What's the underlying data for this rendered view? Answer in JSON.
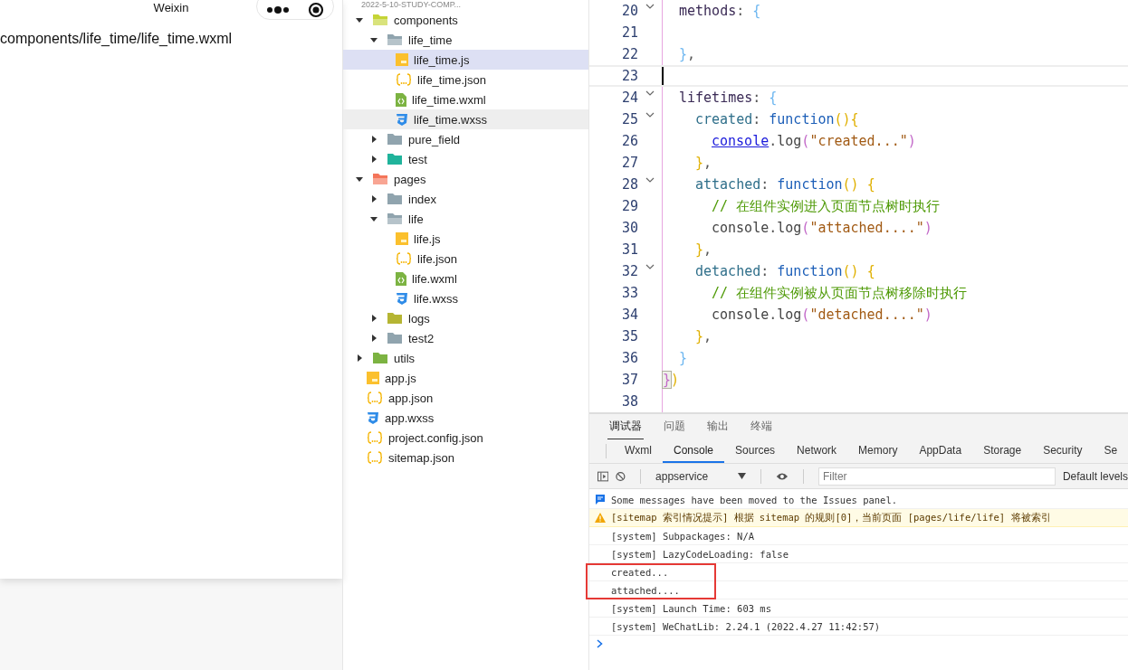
{
  "simulator": {
    "title": "Weixin",
    "page_text": "components/life_time/life_time.wxml"
  },
  "explorer": {
    "project": "2022-5-10-STUDY-COMP...",
    "tree": [
      {
        "name": "components",
        "kind": "folder",
        "color": "#c5d436",
        "expanded": true,
        "selected": false,
        "hovered": false,
        "children": [
          {
            "name": "life_time",
            "kind": "folder",
            "color": "#90a4ae",
            "expanded": true,
            "selected": false,
            "hovered": false,
            "children": [
              {
                "name": "life_time.js",
                "kind": "js",
                "selected": true,
                "hovered": false
              },
              {
                "name": "life_time.json",
                "kind": "json",
                "selected": false,
                "hovered": false
              },
              {
                "name": "life_time.wxml",
                "kind": "wxml",
                "selected": false,
                "hovered": false
              },
              {
                "name": "life_time.wxss",
                "kind": "wxss",
                "selected": false,
                "hovered": true
              }
            ]
          },
          {
            "name": "pure_field",
            "kind": "folder",
            "color": "#90a4ae",
            "expanded": false,
            "selected": false,
            "hovered": false
          },
          {
            "name": "test",
            "kind": "folder",
            "color": "#20b39b",
            "expanded": false,
            "selected": false,
            "hovered": false
          }
        ]
      },
      {
        "name": "pages",
        "kind": "folder",
        "color": "#f4755a",
        "expanded": true,
        "selected": false,
        "hovered": false,
        "children": [
          {
            "name": "index",
            "kind": "folder",
            "color": "#90a4ae",
            "expanded": false,
            "selected": false,
            "hovered": false
          },
          {
            "name": "life",
            "kind": "folder",
            "color": "#90a4ae",
            "expanded": true,
            "selected": false,
            "hovered": false,
            "children": [
              {
                "name": "life.js",
                "kind": "js",
                "selected": false,
                "hovered": false
              },
              {
                "name": "life.json",
                "kind": "json",
                "selected": false,
                "hovered": false
              },
              {
                "name": "life.wxml",
                "kind": "wxml",
                "selected": false,
                "hovered": false
              },
              {
                "name": "life.wxss",
                "kind": "wxss",
                "selected": false,
                "hovered": false
              }
            ]
          },
          {
            "name": "logs",
            "kind": "folder",
            "color": "#b5b533",
            "expanded": false,
            "selected": false,
            "hovered": false
          },
          {
            "name": "test2",
            "kind": "folder",
            "color": "#90a4ae",
            "expanded": false,
            "selected": false,
            "hovered": false
          }
        ]
      },
      {
        "name": "utils",
        "kind": "folder",
        "color": "#7cb342",
        "expanded": false,
        "selected": false,
        "hovered": false
      },
      {
        "name": "app.js",
        "kind": "js",
        "selected": false,
        "hovered": false
      },
      {
        "name": "app.json",
        "kind": "json",
        "selected": false,
        "hovered": false
      },
      {
        "name": "app.wxss",
        "kind": "wxss",
        "selected": false,
        "hovered": false
      },
      {
        "name": "project.config.json",
        "kind": "json",
        "selected": false,
        "hovered": false
      },
      {
        "name": "sitemap.json",
        "kind": "json",
        "selected": false,
        "hovered": false
      }
    ]
  },
  "editor": {
    "lines": [
      {
        "number": "20",
        "foldable": true,
        "current": false,
        "tokens": [
          {
            "text": "methods",
            "kind": "prop"
          },
          {
            "text": ": ",
            "kind": "punct"
          },
          {
            "text": "{",
            "kind": "brace"
          }
        ]
      },
      {
        "number": "21",
        "foldable": false,
        "current": false
      },
      {
        "number": "22",
        "foldable": false,
        "current": false,
        "tokens": [
          {
            "text": "}",
            "kind": "brace"
          },
          {
            "text": ",",
            "kind": "punct"
          }
        ]
      },
      {
        "number": "23",
        "foldable": false,
        "current": true
      },
      {
        "number": "24",
        "foldable": true,
        "current": false,
        "tokens": [
          {
            "text": "lifetimes",
            "kind": "prop"
          },
          {
            "text": ": ",
            "kind": "punct"
          },
          {
            "text": "{",
            "kind": "brace"
          }
        ]
      },
      {
        "number": "25",
        "foldable": true,
        "current": false,
        "tokens": [
          {
            "text": "created",
            "kind": "key"
          },
          {
            "text": ": ",
            "kind": "punct"
          },
          {
            "text": "function",
            "kind": "fn"
          },
          {
            "text": "(){",
            "kind": "brace2"
          }
        ]
      },
      {
        "number": "26",
        "foldable": false,
        "current": false,
        "tokens": [
          {
            "text": "console",
            "kind": "link"
          },
          {
            "text": ".",
            "kind": "punct"
          },
          {
            "text": "log",
            "kind": "ident"
          },
          {
            "text": "(",
            "kind": "paren"
          },
          {
            "text": "\"created...\"",
            "kind": "str"
          },
          {
            "text": ")",
            "kind": "paren"
          }
        ]
      },
      {
        "number": "27",
        "foldable": false,
        "current": false,
        "tokens": [
          {
            "text": "}",
            "kind": "brace2"
          },
          {
            "text": ",",
            "kind": "punct"
          }
        ]
      },
      {
        "number": "28",
        "foldable": true,
        "current": false,
        "tokens": [
          {
            "text": "attached",
            "kind": "key"
          },
          {
            "text": ": ",
            "kind": "punct"
          },
          {
            "text": "function",
            "kind": "fn"
          },
          {
            "text": "() {",
            "kind": "brace2"
          }
        ]
      },
      {
        "number": "29",
        "foldable": false,
        "current": false,
        "tokens": [
          {
            "text": "// 在组件实例进入页面节点树时执行",
            "kind": "comment"
          }
        ]
      },
      {
        "number": "30",
        "foldable": false,
        "current": false,
        "tokens": [
          {
            "text": "console",
            "kind": "ident"
          },
          {
            "text": ".",
            "kind": "punct"
          },
          {
            "text": "log",
            "kind": "ident"
          },
          {
            "text": "(",
            "kind": "paren"
          },
          {
            "text": "\"attached....\"",
            "kind": "str"
          },
          {
            "text": ")",
            "kind": "paren"
          }
        ]
      },
      {
        "number": "31",
        "foldable": false,
        "current": false,
        "tokens": [
          {
            "text": "}",
            "kind": "brace2"
          },
          {
            "text": ",",
            "kind": "punct"
          }
        ]
      },
      {
        "number": "32",
        "foldable": true,
        "current": false,
        "tokens": [
          {
            "text": "detached",
            "kind": "key"
          },
          {
            "text": ": ",
            "kind": "punct"
          },
          {
            "text": "function",
            "kind": "fn"
          },
          {
            "text": "() {",
            "kind": "brace2"
          }
        ]
      },
      {
        "number": "33",
        "foldable": false,
        "current": false,
        "tokens": [
          {
            "text": "// 在组件实例被从页面节点树移除时执行",
            "kind": "comment"
          }
        ]
      },
      {
        "number": "34",
        "foldable": false,
        "current": false,
        "tokens": [
          {
            "text": "console",
            "kind": "ident"
          },
          {
            "text": ".",
            "kind": "punct"
          },
          {
            "text": "log",
            "kind": "ident"
          },
          {
            "text": "(",
            "kind": "paren"
          },
          {
            "text": "\"detached....\"",
            "kind": "str"
          },
          {
            "text": ")",
            "kind": "paren"
          }
        ]
      },
      {
        "number": "35",
        "foldable": false,
        "current": false,
        "tokens": [
          {
            "text": "}",
            "kind": "brace2"
          },
          {
            "text": ",",
            "kind": "punct"
          }
        ]
      },
      {
        "number": "36",
        "foldable": false,
        "current": false,
        "tokens": [
          {
            "text": "}",
            "kind": "brace"
          }
        ]
      },
      {
        "number": "37",
        "foldable": false,
        "current": false,
        "tokens": [
          {
            "text": "}",
            "kind": "match"
          },
          {
            "text": ")",
            "kind": "brace2"
          }
        ]
      },
      {
        "number": "38",
        "foldable": false,
        "current": false
      }
    ]
  },
  "devtools": {
    "panel_tabs": [
      {
        "label": "调试器",
        "selected": true
      },
      {
        "label": "问题",
        "selected": false
      },
      {
        "label": "输出",
        "selected": false
      },
      {
        "label": "终端",
        "selected": false
      }
    ],
    "tool_tabs": [
      {
        "label": "Wxml",
        "selected": false
      },
      {
        "label": "Console",
        "selected": true
      },
      {
        "label": "Sources",
        "selected": false
      },
      {
        "label": "Network",
        "selected": false
      },
      {
        "label": "Memory",
        "selected": false
      },
      {
        "label": "AppData",
        "selected": false
      },
      {
        "label": "Storage",
        "selected": false
      },
      {
        "label": "Security",
        "selected": false
      },
      {
        "label": "Se",
        "selected": false
      }
    ],
    "context": "appservice",
    "filter": {
      "placeholder": "Filter"
    },
    "levels": "Default levels",
    "messages": [
      {
        "kind": "info",
        "text": "Some messages have been moved to the Issues panel.",
        "highlighted": false
      },
      {
        "kind": "warning",
        "text": "[sitemap 索引情况提示] 根据 sitemap 的规则[0]，当前页面 [pages/life/life] 将被索引",
        "highlighted": false
      },
      {
        "kind": "log",
        "text": "[system] Subpackages: N/A",
        "highlighted": false
      },
      {
        "kind": "log",
        "text": "[system] LazyCodeLoading: false",
        "highlighted": false
      },
      {
        "kind": "log",
        "text": "created...",
        "highlighted": true
      },
      {
        "kind": "log",
        "text": "attached....",
        "highlighted": true
      },
      {
        "kind": "log",
        "text": "[system] Launch Time: 603 ms",
        "highlighted": false
      },
      {
        "kind": "log",
        "text": "[system] WeChatLib: 2.24.1 (2022.4.27 11:42:57)",
        "highlighted": false
      }
    ]
  }
}
